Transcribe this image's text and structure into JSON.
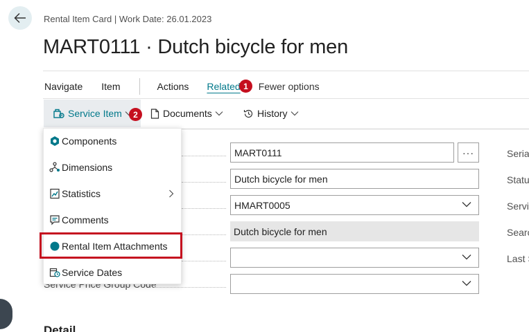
{
  "header": {
    "breadcrumb": "Rental Item Card | Work Date: 26.01.2023",
    "title": "MART0111 · Dutch bicycle for men"
  },
  "tabs": [
    {
      "label": "Navigate"
    },
    {
      "label": "Item"
    },
    {
      "label": "Actions"
    },
    {
      "label": "Related",
      "active": true
    },
    {
      "label": "Fewer options"
    }
  ],
  "badges": {
    "first": "1",
    "second": "2"
  },
  "subbar": {
    "service_item": "Service Item",
    "documents": "Documents",
    "history": "History"
  },
  "menu": {
    "items": [
      {
        "label": "Components",
        "icon": "components-icon"
      },
      {
        "label": "Dimensions",
        "icon": "dimensions-icon"
      },
      {
        "label": "Statistics",
        "icon": "statistics-icon",
        "has_submenu": true
      },
      {
        "label": "Comments",
        "icon": "comments-icon"
      },
      {
        "label": "Rental Item Attachments",
        "icon": "attachment-dot-icon",
        "highlighted": true
      },
      {
        "label": "Service Dates",
        "icon": "service-dates-icon"
      }
    ]
  },
  "fields": {
    "no_value": "MART0111",
    "description_value": "Dutch bicycle for men",
    "item_value": "HMART0005",
    "item_description_value": "Dutch bicycle for men",
    "empty_dropdown_value": "",
    "service_price_group_label": "Service Price Group Code",
    "service_price_group_value": "",
    "ellipsis": "···"
  },
  "right_labels": [
    "Serial",
    "Status",
    "Servic",
    "Searc",
    "Last S"
  ],
  "detail_heading": "Detail",
  "colors": {
    "accent": "#00788a",
    "badge": "#c50f1f",
    "highlight_border": "#c50f1f",
    "teal_dot": "#00788a"
  }
}
